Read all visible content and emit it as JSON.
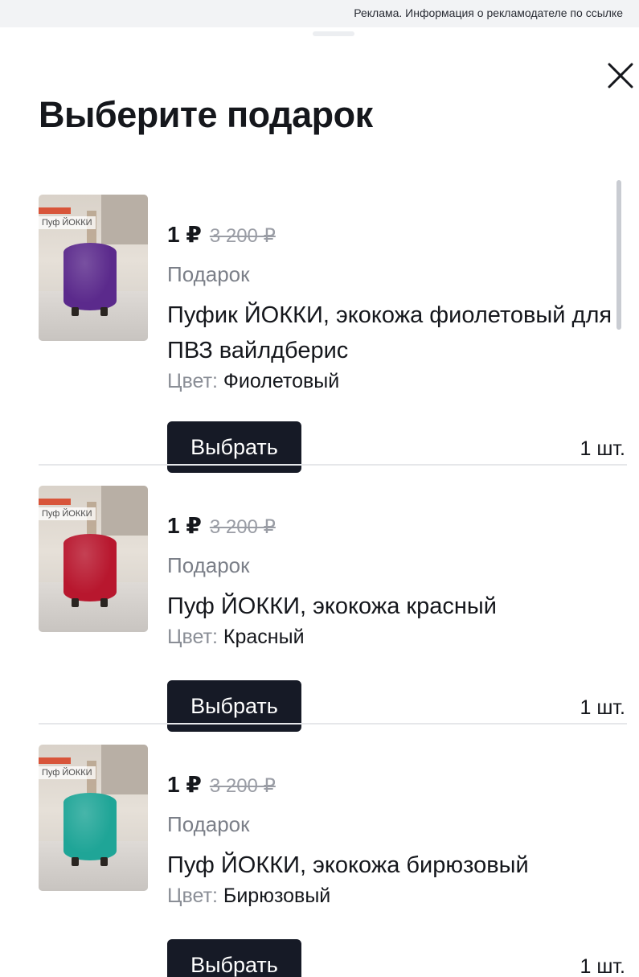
{
  "ad_note": "Реклама. Информация о рекламодателе по ссылке",
  "title": "Выберите подарок",
  "icons": {
    "close": "close-icon"
  },
  "products": [
    {
      "price": "1 ₽",
      "old_price": "3 200 ₽",
      "label": "Подарок",
      "name": "Пуфик ЙОККИ, экокожа фиолетовый для ПВЗ вайлдберис",
      "color_key": "Цвет:",
      "color_value": "Фиолетовый",
      "button": "Выбрать",
      "qty": "1 шт.",
      "thumb_brand": "Пуф ЙОККИ",
      "pouf_color": "#5b2a8c"
    },
    {
      "price": "1 ₽",
      "old_price": "3 200 ₽",
      "label": "Подарок",
      "name": "Пуф ЙОККИ, экокожа красный",
      "color_key": "Цвет:",
      "color_value": "Красный",
      "button": "Выбрать",
      "qty": "1 шт.",
      "thumb_brand": "Пуф ЙОККИ",
      "pouf_color": "#b8172e"
    },
    {
      "price": "1 ₽",
      "old_price": "3 200 ₽",
      "label": "Подарок",
      "name": "Пуф ЙОККИ, экокожа бирюзовый",
      "color_key": "Цвет:",
      "color_value": "Бирюзовый",
      "button": "Выбрать",
      "qty": "1 шт.",
      "thumb_brand": "Пуф ЙОККИ",
      "pouf_color": "#1fa597"
    }
  ],
  "colors": {
    "button_bg": "#161a26",
    "button_text": "#ffffff",
    "old_price": "#9a9da5",
    "secondary_text": "#7b7f88"
  }
}
